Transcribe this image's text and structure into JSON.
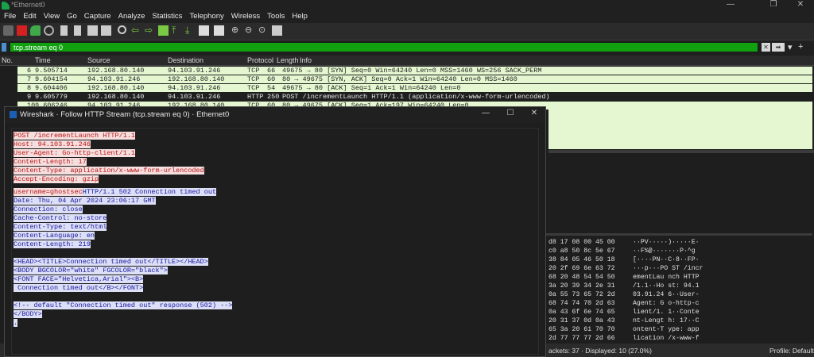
{
  "window": {
    "title": "*Ethernet0",
    "controls": [
      "—",
      "❐",
      "✕"
    ]
  },
  "menu": [
    "File",
    "Edit",
    "View",
    "Go",
    "Capture",
    "Analyze",
    "Statistics",
    "Telephony",
    "Wireless",
    "Tools",
    "Help"
  ],
  "filter": {
    "value": "tcp.stream eq 0"
  },
  "columns": [
    "No.",
    "Time",
    "Source",
    "Destination",
    "Protocol",
    "Length",
    "Info"
  ],
  "packets": [
    {
      "no": "6",
      "time": "9.505714",
      "src": "192.168.80.140",
      "dst": "94.103.91.246",
      "proto": "TCP",
      "len": "66",
      "info": "49675 → 80 [SYN] Seq=0 Win=64240 Len=0 MSS=1460 WS=256 SACK_PERM"
    },
    {
      "no": "7",
      "time": "9.604154",
      "src": "94.103.91.246",
      "dst": "192.168.80.140",
      "proto": "TCP",
      "len": "60",
      "info": "80 → 49675 [SYN, ACK] Seq=0 Ack=1 Win=64240 Len=0 MSS=1460"
    },
    {
      "no": "8",
      "time": "9.604406",
      "src": "192.168.80.140",
      "dst": "94.103.91.246",
      "proto": "TCP",
      "len": "54",
      "info": "49675 → 80 [ACK] Seq=1 Ack=1 Win=64240 Len=0"
    },
    {
      "no": "9",
      "time": "9.605779",
      "src": "192.168.80.140",
      "dst": "94.103.91.246",
      "proto": "HTTP",
      "len": "250",
      "info": "POST /incrementLaunch HTTP/1.1  (application/x-www-form-urlencoded)"
    },
    {
      "no": "10",
      "time": "9.606246",
      "src": "94.103.91.246",
      "dst": "192.168.80.140",
      "proto": "TCP",
      "len": "60",
      "info": "80 → 49675 [ACK] Seq=1 Ack=197 Win=64240 Len=0"
    }
  ],
  "dialog": {
    "title": "Wireshark · Follow HTTP Stream (tcp.stream eq 0) · Ethernet0",
    "request_lines": [
      "POST /incrementLaunch HTTP/1.1",
      "Host: 94.103.91.246",
      "User-Agent: Go-http-client/1.1",
      "Content-Length: 17",
      "Content-Type: application/x-www-form-urlencoded",
      "Accept-Encoding: gzip"
    ],
    "request_body": "username=ghostsec",
    "response_first": "HTTP/1.1 502 Connection timed out",
    "response_lines": [
      "Date: Thu, 04 Apr 2024 23:06:17 GMT",
      "Connection: close",
      "Cache-Control: no-store",
      "Content-Type: text/html",
      "Content-Language: en",
      "Content-Length: 219"
    ],
    "html_lines": [
      "<HEAD><TITLE>Connection timed out</TITLE></HEAD>",
      "<BODY BGCOLOR=\"white\" FGCOLOR=\"black\">",
      "<FONT FACE=\"Helvetica,Arial\"><B>",
      " Connection timed out</B></FONT>"
    ],
    "html_comment": "<!-- default \"Connection timed out\" response (502) -->",
    "html_end": "</BODY>",
    "html_last": "."
  },
  "hex": [
    {
      "hex": "d8 17 08 00 45 00",
      "ascii": "··PV·····)·····E·"
    },
    {
      "hex": "c0 a8 50 8c 5e 67",
      "ascii": "··F%@·······P·^g"
    },
    {
      "hex": "38 84 05 46 50 18",
      "ascii": "[····PN··C·8··FP·"
    },
    {
      "hex": "20 2f 69 6e 63 72",
      "ascii": "···p···PO ST /incr"
    },
    {
      "hex": "68 20 48 54 54 50",
      "ascii": "ementLau nch HTTP"
    },
    {
      "hex": "3a 20 39 34 2e 31",
      "ascii": "/1.1··Ho st: 94.1"
    },
    {
      "hex": "0a 55 73 65 72 2d",
      "ascii": "03.91.24 6··User-"
    },
    {
      "hex": "68 74 74 70 2d 63",
      "ascii": "Agent: G o-http-c"
    },
    {
      "hex": "0a 43 6f 6e 74 65",
      "ascii": "lient/1. 1··Conte"
    },
    {
      "hex": "20 31 37 0d 0a 43",
      "ascii": "nt-Lengt h: 17··C"
    },
    {
      "hex": "65 3a 20 61 70 70",
      "ascii": "ontent-T ype: app"
    },
    {
      "hex": "2d 77 77 77 2d 66",
      "ascii": "lication /x-www-f"
    }
  ],
  "status": {
    "packets": "ackets: 37 · Displayed: 10 (27.0%)",
    "profile": "Profile: Default"
  },
  "colors": {
    "packet_row_bg": "#e4f7d0",
    "filter_valid": "#10a010",
    "request_red": "#bb1515",
    "response_blue": "#1818a0"
  }
}
